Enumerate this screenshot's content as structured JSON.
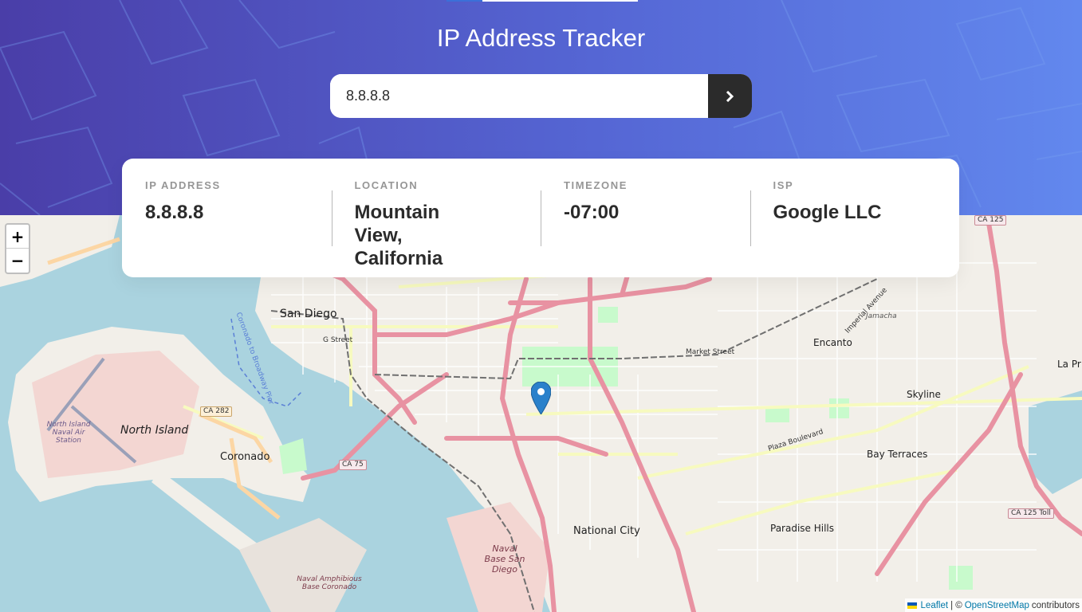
{
  "header": {
    "title": "IP Address Tracker"
  },
  "search": {
    "value": "8.8.8.8",
    "button_icon": "chevron-right-icon"
  },
  "info": {
    "ip": {
      "label": "IP ADDRESS",
      "value": "8.8.8.8"
    },
    "location": {
      "label": "LOCATION",
      "value": "Mountain View, California"
    },
    "timezone": {
      "label": "TIMEZONE",
      "value": "-07:00"
    },
    "isp": {
      "label": "ISP",
      "value": "Google LLC"
    }
  },
  "map": {
    "zoom_in": "+",
    "zoom_out": "−",
    "attribution": {
      "leaflet": "Leaflet",
      "separator": "| ©",
      "osm": "OpenStreetMap",
      "suffix": "contributors"
    },
    "labels": {
      "san_diego": "San Diego",
      "north_island": "North Island",
      "north_island_station": "North Island Naval Air Station",
      "coronado": "Coronado",
      "national_city": "National City",
      "paradise_hills": "Paradise Hills",
      "bay_terraces": "Bay Terraces",
      "skyline": "Skyline",
      "encanto": "Encanto",
      "la_presa": "La Pr",
      "jamacha": "Jamacha",
      "naval_base": "Naval Base San Diego",
      "naval_amphibious": "Naval Amphibious Base Coronado",
      "g_street": "G Street",
      "market_street": "Market Street",
      "plaza_boulevard": "Plaza Boulevard",
      "imperial_avenue": "Imperial Avenue",
      "broadway_pier": "Coronado to Broadway Pier",
      "ca_125": "CA 125",
      "ca_282": "CA 282",
      "ca_75": "CA 75",
      "ca_125_toll": "CA 125 Toll"
    },
    "colors": {
      "water": "#aad3df",
      "land": "#f2efe9",
      "motorway": "#e892a2",
      "primary": "#fcd6a4",
      "secondary": "#f7fabf",
      "park": "#c8facc",
      "military": "#f3d6d2",
      "marker": "#2a81cb"
    }
  }
}
